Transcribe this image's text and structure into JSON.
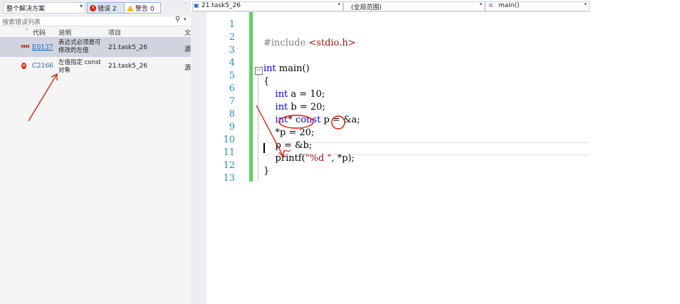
{
  "error_list": {
    "scope_label": "整个解决方案",
    "errors_badge": "错误 2",
    "warnings_badge": "警告 0",
    "search_placeholder": "搜索错误列表",
    "columns": {
      "code": "代码",
      "description": "说明",
      "project": "项目",
      "truncated": "文"
    },
    "rows": [
      {
        "code": "E0137",
        "description": "表达式必须是可修改的左值",
        "project": "21.task5_26",
        "trunc": "源",
        "kind": "intellisense"
      },
      {
        "code": "C2166",
        "description": "左值指定 const 对象",
        "project": "21.task5_26",
        "trunc": "源",
        "kind": "error"
      }
    ]
  },
  "editor": {
    "project_dropdown": "21.task5_26",
    "scope_dropdown": "(全局范围)",
    "function_dropdown": "main()",
    "line_numbers": [
      "1",
      "2",
      "3",
      "4",
      "5",
      "6",
      "7",
      "8",
      "9",
      "10",
      "11",
      "12",
      "13"
    ],
    "lines": [
      "",
      "",
      "#include <stdio.h>",
      "",
      "int main()",
      "{",
      "    int a = 10;",
      "    int b = 20;",
      "    int* const p = &a;",
      "    *p = 20;",
      "    p = &b;",
      "    printf(\"%d \", *p);",
      "}"
    ]
  },
  "colors": {
    "keyword": "#0000ff",
    "string": "#a31515",
    "line_number": "#2b91af",
    "change_bar": "#59d35e",
    "annotation": "#e51400"
  }
}
